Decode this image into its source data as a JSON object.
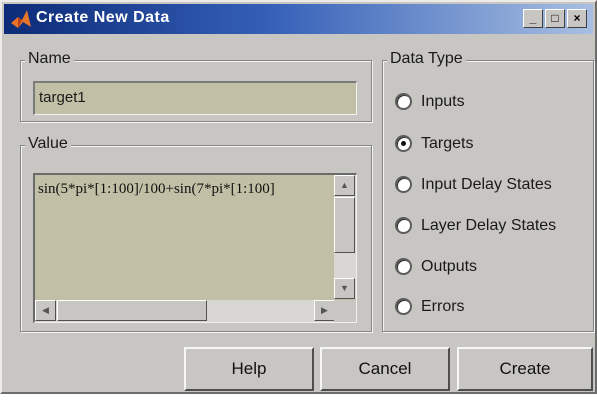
{
  "window": {
    "title": "Create New Data",
    "controls": {
      "minimize": "_",
      "maximize": "□",
      "close": "×"
    }
  },
  "name_group": {
    "label": "Name",
    "value": "target1"
  },
  "value_group": {
    "label": "Value",
    "value": "sin(5*pi*[1:100]/100+sin(7*pi*[1:100]",
    "scroll_arrows": {
      "up": "▲",
      "down": "▼",
      "left": "◀",
      "right": "▶"
    }
  },
  "data_type": {
    "label": "Data Type",
    "selected": "Targets",
    "options": [
      "Inputs",
      "Targets",
      "Input Delay States",
      "Layer Delay States",
      "Outputs",
      "Errors"
    ]
  },
  "buttons": {
    "help": "Help",
    "cancel": "Cancel",
    "create": "Create"
  },
  "colors": {
    "title_bar_dark": "#0c2b78",
    "title_bar_light": "#a8bfe2",
    "window_face": "#c8c6c2",
    "field_background": "#c1c0a6"
  },
  "icons": {
    "app": "matlab-logo-icon"
  }
}
